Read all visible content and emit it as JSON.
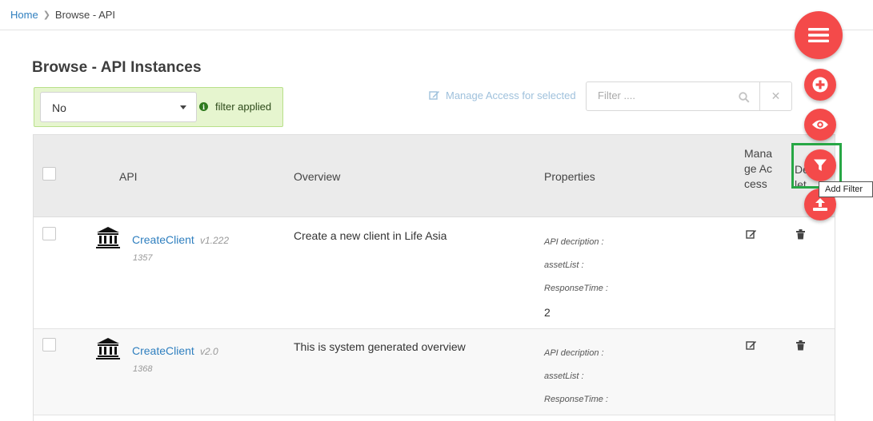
{
  "breadcrumb": {
    "home": "Home",
    "current": "Browse - API"
  },
  "page": {
    "title": "Browse - API Instances"
  },
  "filter": {
    "selected": "No",
    "status": "filter applied"
  },
  "toolbar": {
    "manage_access": "Manage Access for selected",
    "search_placeholder": "Filter ...."
  },
  "table": {
    "headers": {
      "api": "API",
      "overview": "Overview",
      "properties": "Properties",
      "manage_access": "Manage Access",
      "delete": "Delete"
    },
    "rows": [
      {
        "name": "CreateClient",
        "version": "v1.222",
        "id": "1357",
        "overview": "Create a new client in Life Asia",
        "props": [
          "API decription :",
          "assetList :",
          "ResponseTime :"
        ],
        "response_value": "2"
      },
      {
        "name": "CreateClient",
        "version": "v2.0",
        "id": "1368",
        "overview": "This is system generated overview",
        "props": [
          "API decription :",
          "assetList :",
          "ResponseTime :"
        ]
      }
    ]
  },
  "tooltip": "Add Filter",
  "colors": {
    "fab": "#f44a4a",
    "link": "#2f7fbf",
    "filter_bg": "#e6f5cf",
    "highlight": "#27a745"
  },
  "icons": {
    "fab_menu": "menu-icon",
    "fab_add": "plus-icon",
    "fab_view": "eye-icon",
    "fab_filter": "filter-icon",
    "fab_upload": "upload-icon",
    "api": "institution-icon",
    "edit": "edit-icon",
    "delete": "trash-icon"
  }
}
